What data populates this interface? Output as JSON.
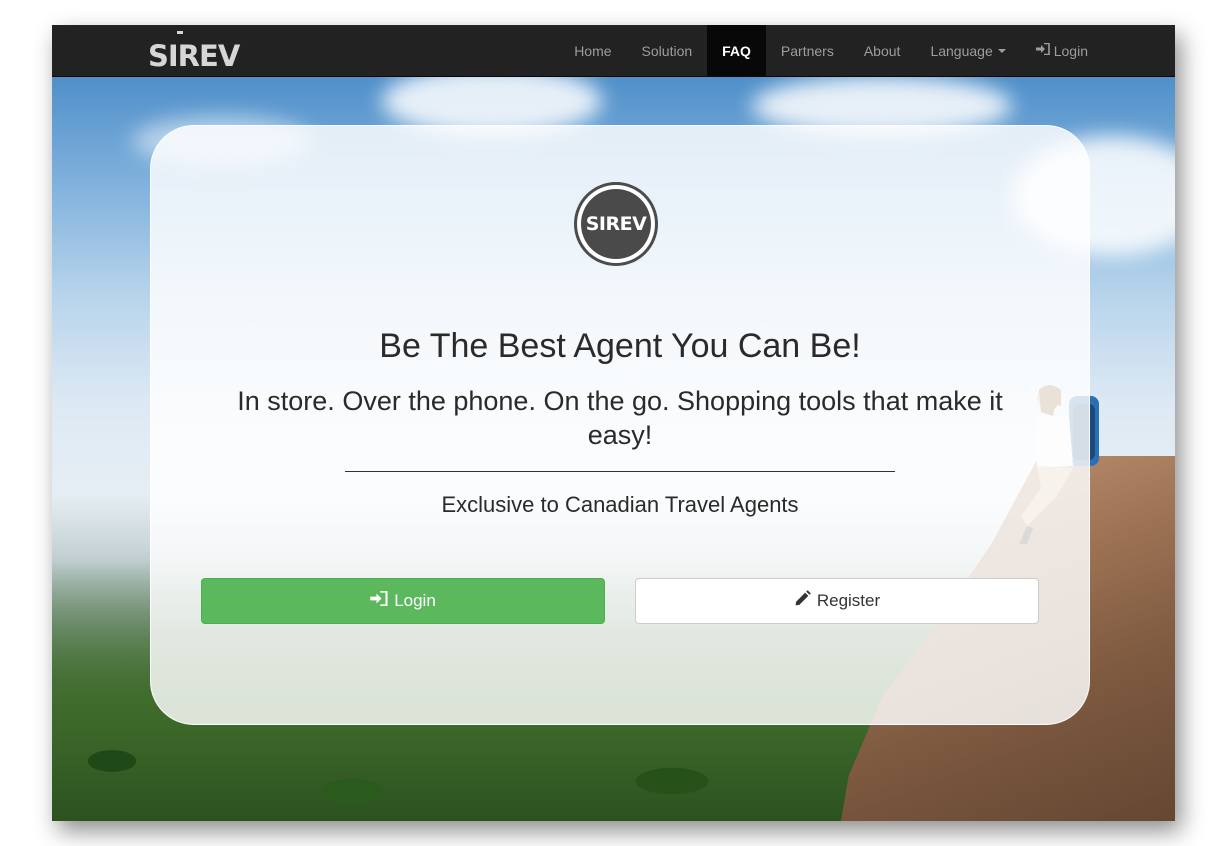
{
  "navbar": {
    "brand": "SIREV",
    "items": [
      {
        "label": "Home",
        "active": false
      },
      {
        "label": "Solution",
        "active": false
      },
      {
        "label": "FAQ",
        "active": true
      },
      {
        "label": "Partners",
        "active": false
      },
      {
        "label": "About",
        "active": false
      },
      {
        "label": "Language",
        "active": false
      },
      {
        "label": "Login",
        "active": false
      }
    ]
  },
  "hero": {
    "logo_text": "SIREV",
    "headline": "Be The Best Agent You Can Be!",
    "subheadline": "In store. Over the phone. On the go. Shopping tools that make it easy!",
    "tagline": "Exclusive to Canadian Travel Agents",
    "login_button": "Login",
    "register_button": "Register"
  },
  "icons": {
    "login": "sign-in-icon",
    "register": "pencil-icon",
    "language": "caret-down-icon"
  },
  "colors": {
    "navbar_bg": "#222222",
    "navbar_active_bg": "#080808",
    "login_button": "#5cb85c",
    "register_button": "#ffffff"
  }
}
